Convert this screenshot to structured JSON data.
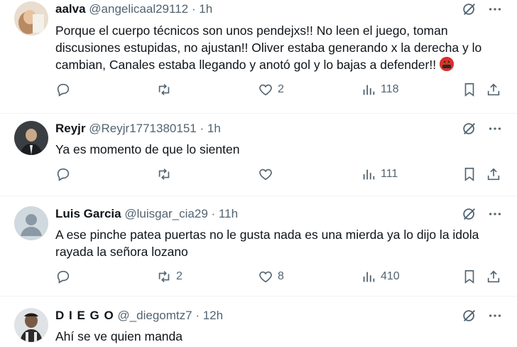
{
  "tweets": [
    {
      "name": "aalva",
      "handle": "@angelicaal29112",
      "sep": "·",
      "time": "1h",
      "text": "Porque el cuerpo técnicos son unos pendejxs!! No leen el juego, toman discusiones estupidas, no ajustan!! Oliver estaba generando x la derecha y lo cambian, Canales estaba llegando y anotó gol y lo bajas a defender!!",
      "emoji": "angry-swearing-face",
      "replies": "",
      "reposts": "",
      "likes": "2",
      "views": "118"
    },
    {
      "name": "Reyjr",
      "handle": "@Reyjr1771380151",
      "sep": "·",
      "time": "1h",
      "text": "Ya es momento de que lo sienten",
      "replies": "",
      "reposts": "",
      "likes": "",
      "views": "111"
    },
    {
      "name": "Luis Garcia",
      "handle": "@luisgar_cia29",
      "sep": "·",
      "time": "11h",
      "text": "A ese pinche patea puertas no le gusta nada es una mierda ya lo dijo la idola rayada la señora lozano",
      "replies": "",
      "reposts": "2",
      "likes": "8",
      "views": "410"
    },
    {
      "name": "D I E G O",
      "handle": "@_diegomtz7",
      "sep": "·",
      "time": "12h",
      "text": "Ahí se ve quien manda"
    }
  ],
  "icons": {
    "grok": "grok-icon",
    "more": "more-icon",
    "reply": "reply-icon",
    "repost": "repost-icon",
    "like": "heart-icon",
    "views": "views-icon",
    "bookmark": "bookmark-icon",
    "share": "share-icon"
  },
  "colors": {
    "text": "#0f1419",
    "secondary": "#536471",
    "divider": "#eff3f4"
  }
}
